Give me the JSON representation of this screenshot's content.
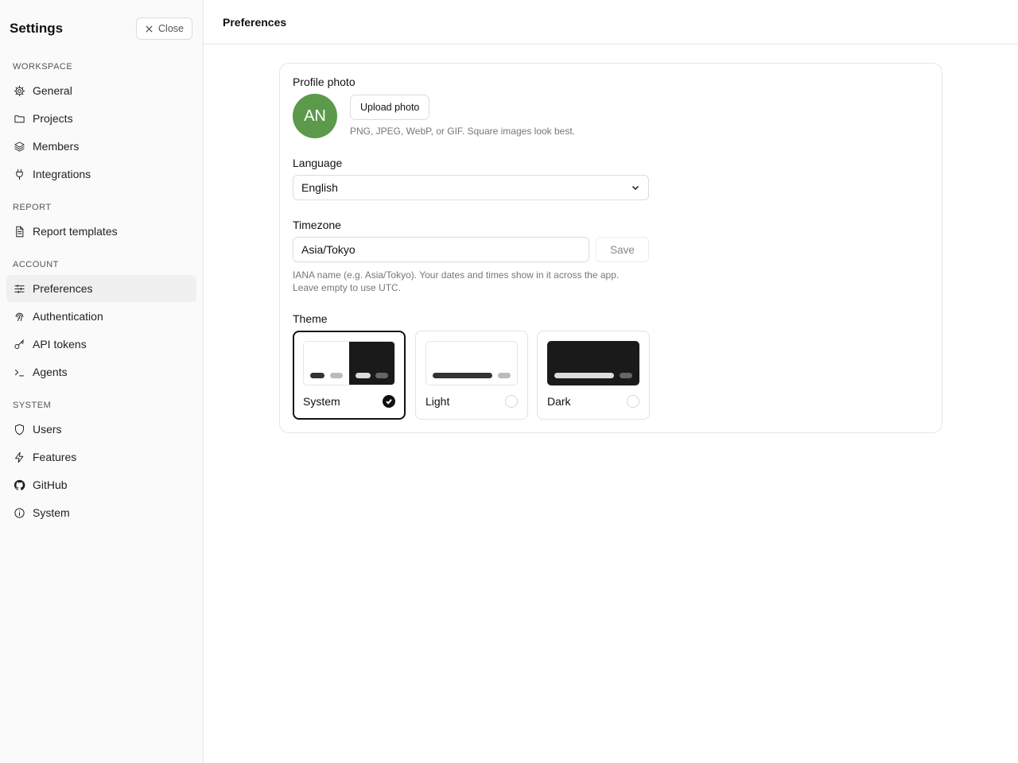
{
  "sidebar": {
    "title": "Settings",
    "close_label": "Close",
    "sections": [
      {
        "label": "WORKSPACE",
        "items": [
          {
            "label": "General",
            "icon": "gear-icon"
          },
          {
            "label": "Projects",
            "icon": "folder-icon"
          },
          {
            "label": "Members",
            "icon": "layers-icon"
          },
          {
            "label": "Integrations",
            "icon": "plug-icon"
          }
        ]
      },
      {
        "label": "REPORT",
        "items": [
          {
            "label": "Report templates",
            "icon": "file-text-icon"
          }
        ]
      },
      {
        "label": "ACCOUNT",
        "items": [
          {
            "label": "Preferences",
            "icon": "sliders-icon",
            "active": true
          },
          {
            "label": "Authentication",
            "icon": "fingerprint-icon"
          },
          {
            "label": "API tokens",
            "icon": "key-icon"
          },
          {
            "label": "Agents",
            "icon": "terminal-icon"
          }
        ]
      },
      {
        "label": "SYSTEM",
        "items": [
          {
            "label": "Users",
            "icon": "shield-icon"
          },
          {
            "label": "Features",
            "icon": "zap-icon"
          },
          {
            "label": "GitHub",
            "icon": "github-icon"
          },
          {
            "label": "System",
            "icon": "info-icon"
          }
        ]
      }
    ]
  },
  "header": {
    "title": "Preferences"
  },
  "profile": {
    "label": "Profile photo",
    "initials": "AN",
    "avatar_color": "#5a9a4a",
    "upload_label": "Upload photo",
    "hint": "PNG, JPEG, WebP, or GIF. Square images look best."
  },
  "language": {
    "label": "Language",
    "value": "English"
  },
  "timezone": {
    "label": "Timezone",
    "value": "Asia/Tokyo",
    "save_label": "Save",
    "hint_line1": "IANA name (e.g. Asia/Tokyo). Your dates and times show in it across the app.",
    "hint_line2": "Leave empty to use UTC."
  },
  "theme": {
    "label": "Theme",
    "options": [
      {
        "name": "System",
        "selected": true
      },
      {
        "name": "Light",
        "selected": false
      },
      {
        "name": "Dark",
        "selected": false
      }
    ]
  }
}
